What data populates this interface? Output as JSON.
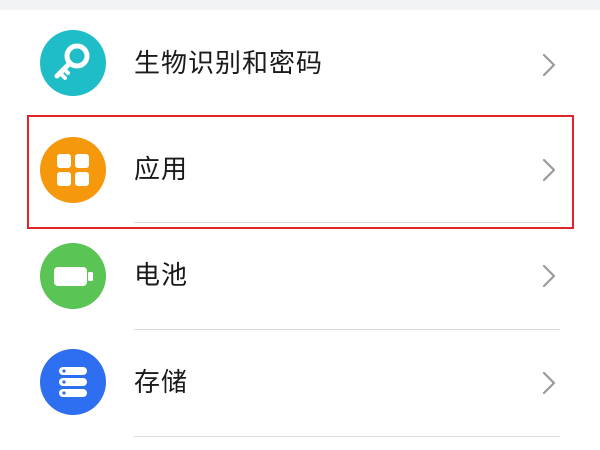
{
  "settings_list": {
    "items": [
      {
        "label": "生物识别和密码",
        "icon": "key-icon",
        "icon_color": "#1fbdc7"
      },
      {
        "label": "应用",
        "icon": "apps-grid-icon",
        "icon_color": "#f6980b"
      },
      {
        "label": "电池",
        "icon": "battery-icon",
        "icon_color": "#5ac455"
      },
      {
        "label": "存储",
        "icon": "storage-icon",
        "icon_color": "#2d6ff0"
      }
    ]
  },
  "highlight": {
    "color": "#e0262b",
    "target": "应用"
  }
}
